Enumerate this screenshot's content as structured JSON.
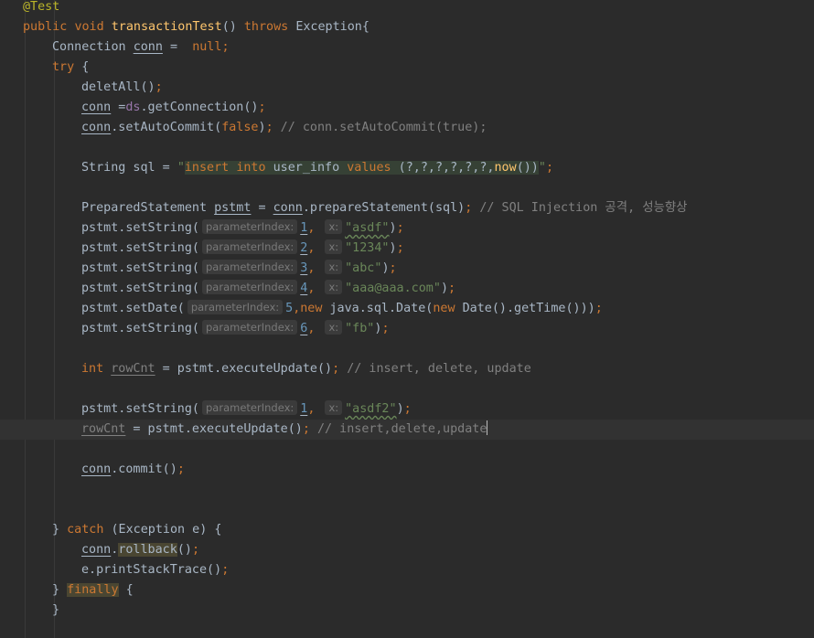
{
  "editor": {
    "annotation": "@Test",
    "method_signature": {
      "kw_public": "public",
      "kw_void": "void",
      "name": "transactionTest",
      "parens": "()",
      "kw_throws": "throws",
      "exception": "Exception{"
    },
    "conn_decl": {
      "type": "Connection",
      "var": "conn",
      "assign": " =  ",
      "null": "null",
      "semi": ";"
    },
    "try_open": {
      "kw": "try",
      "brace": " {"
    },
    "delete_all": {
      "call": "deletAll()",
      "semi": ";"
    },
    "get_connection": {
      "var": "conn",
      "assign": " =",
      "field": "ds",
      "call": ".getConnection()",
      "semi": ";"
    },
    "auto_commit": {
      "var": "conn",
      "call": ".setAutoCommit(",
      "arg": "false",
      "close": ")",
      "semi": ";",
      "comment": " // conn.setAutoCommit(true);"
    },
    "sql_decl": {
      "prefix": "String sql = ",
      "q_open": "\"",
      "s1": "insert ",
      "s2": "into",
      "s3": " user_info ",
      "s4": "values",
      "s5": " (?,?,?,?,?,?,",
      "s6": "now",
      "s7": "())",
      "q_close": "\"",
      "semi": ";"
    },
    "prepare": {
      "type": "PreparedStatement ",
      "var": "pstmt",
      "assign": " = ",
      "conn": "conn",
      "call": ".prepareStatement(sql)",
      "semi": ";",
      "comment": " // SQL Injection 공격, 성능향상"
    },
    "set_calls": [
      {
        "call": "pstmt.setString(",
        "hint": "parameterIndex:",
        "idx": "1",
        "sep": ",",
        "xhint": "x:",
        "value": "\"asdf\"",
        "close": ")",
        "semi": ";"
      },
      {
        "call": "pstmt.setString(",
        "hint": "parameterIndex:",
        "idx": "2",
        "sep": ",",
        "xhint": "x:",
        "value": "\"1234\"",
        "close": ")",
        "semi": ";"
      },
      {
        "call": "pstmt.setString(",
        "hint": "parameterIndex:",
        "idx": "3",
        "sep": ",",
        "xhint": "x:",
        "value": "\"abc\"",
        "close": ")",
        "semi": ";"
      },
      {
        "call": "pstmt.setString(",
        "hint": "parameterIndex:",
        "idx": "4",
        "sep": ",",
        "xhint": "x:",
        "value": "\"aaa@aaa.com\"",
        "close": ")",
        "semi": ";"
      }
    ],
    "set_date": {
      "call": "pstmt.setDate(",
      "hint": "parameterIndex:",
      "idx": "5",
      "sep": ",",
      "new1": "new",
      "mid": " java.sql.Date(",
      "new2": "new",
      "tail": " Date().getTime()))",
      "semi": ";"
    },
    "set_string6": {
      "call": "pstmt.setString(",
      "hint": "parameterIndex:",
      "idx": "6",
      "sep": ",",
      "xhint": "x:",
      "value": "\"fb\"",
      "close": ")",
      "semi": ";"
    },
    "row_cnt_decl": {
      "kw": "int",
      "var": "rowCnt",
      "rest": " = pstmt.executeUpdate()",
      "semi": ";",
      "comment": " // insert, delete, update"
    },
    "set_string_again": {
      "call": "pstmt.setString(",
      "hint": "parameterIndex:",
      "idx": "1",
      "sep": ",",
      "xhint": "x:",
      "value": "\"asdf2\"",
      "close": ")",
      "semi": ";"
    },
    "row_cnt_assign": {
      "var": "rowCnt",
      "rest": " = pstmt.executeUpdate()",
      "semi": ";",
      "comment": " // insert,delete,update"
    },
    "commit": {
      "var": "conn",
      "call": ".commit()",
      "semi": ";"
    },
    "catch_line": {
      "brace": "} ",
      "kw": "catch",
      "rest": " (Exception e) {"
    },
    "rollback": {
      "var": "conn",
      "dot": ".",
      "call": "rollback",
      "rest": "()",
      "semi": ";"
    },
    "print_stack": {
      "call": "e.printStackTrace()",
      "semi": ";"
    },
    "finally_line": {
      "brace": "} ",
      "kw": "finally",
      "rest": " {"
    },
    "close_brace": "}",
    "colors": {
      "background": "#2b2b2b",
      "keyword": "#cc7832",
      "method": "#ffc66d",
      "string": "#6a8759",
      "number": "#6897bb",
      "comment": "#808080",
      "annotation": "#bbb529",
      "field": "#9876aa"
    }
  }
}
